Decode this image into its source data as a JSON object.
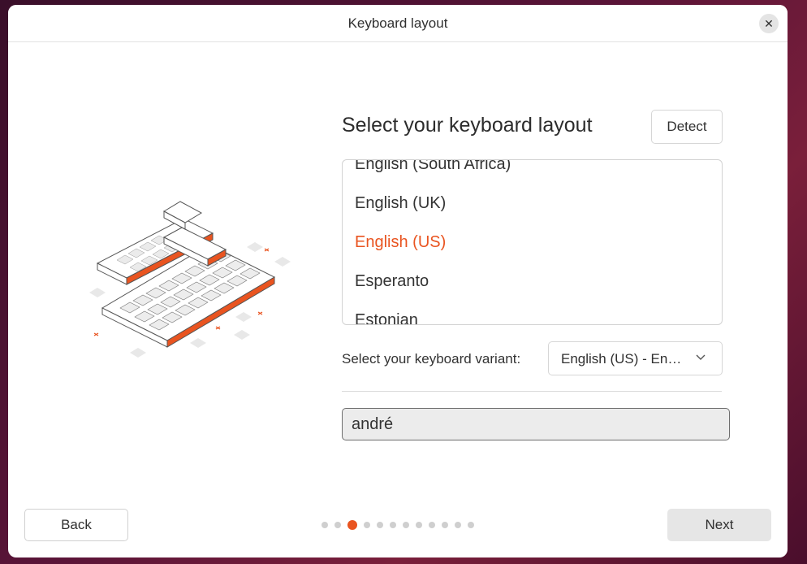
{
  "window": {
    "title": "Keyboard layout",
    "close_icon": "close-icon"
  },
  "illustration": {
    "icon": "keyboard-illustration"
  },
  "main": {
    "heading": "Select your keyboard layout",
    "detect_label": "Detect",
    "layouts": [
      {
        "label": "English (South Africa)",
        "selected": false
      },
      {
        "label": "English (UK)",
        "selected": false
      },
      {
        "label": "English (US)",
        "selected": true
      },
      {
        "label": "Esperanto",
        "selected": false
      },
      {
        "label": "Estonian",
        "selected": false
      }
    ],
    "variant_label": "Select your keyboard variant:",
    "variant_value": "English (US) - English (US)",
    "test_input_value": "andré"
  },
  "footer": {
    "back_label": "Back",
    "next_label": "Next",
    "steps_total": 12,
    "current_step": 3
  },
  "colors": {
    "accent": "#e95420",
    "text": "#303030",
    "background": "#ffffff"
  }
}
